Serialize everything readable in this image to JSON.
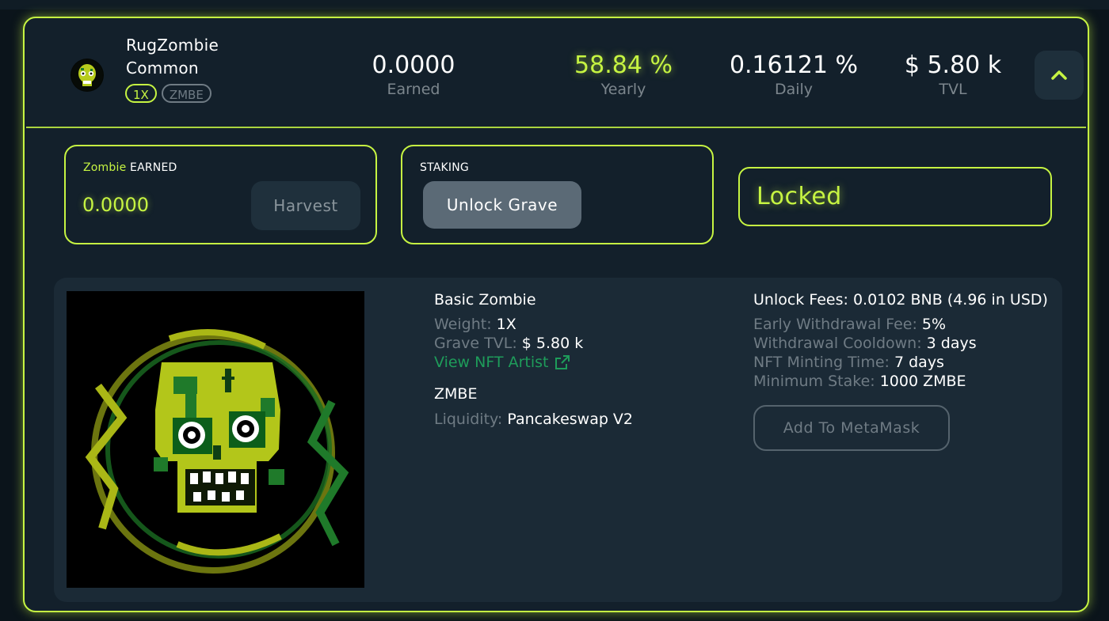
{
  "grave": {
    "name_line1": "RugZombie",
    "name_line2": "Common",
    "multiplier_badge": "1X",
    "token_badge": "ZMBE"
  },
  "stats": {
    "earned_value": "0.0000",
    "earned_label": "Earned",
    "yearly_value": "58.84 %",
    "yearly_label": "Yearly",
    "daily_value": "0.16121 %",
    "daily_label": "Daily",
    "tvl_value": "$ 5.80 k",
    "tvl_label": "TVL"
  },
  "earned_panel": {
    "title_accent": "Zombie",
    "title_rest": "EARNED",
    "value": "0.0000",
    "harvest_label": "Harvest"
  },
  "staking_panel": {
    "title": "STAKING",
    "unlock_label": "Unlock Grave"
  },
  "status": {
    "locked_label": "Locked"
  },
  "details": {
    "nft_name": "Basic Zombie",
    "weight_label": "Weight:",
    "weight_value": "1X",
    "grave_tvl_label": "Grave TVL:",
    "grave_tvl_value": "$ 5.80 k",
    "artist_link": "View NFT Artist",
    "token_name": "ZMBE",
    "liquidity_label": "Liquidity:",
    "liquidity_value": "Pancakeswap V2",
    "unlock_fees": "Unlock Fees: 0.0102 BNB (4.96 in USD)",
    "early_fee_label": "Early Withdrawal Fee:",
    "early_fee_value": "5%",
    "cooldown_label": "Withdrawal Cooldown:",
    "cooldown_value": "3 days",
    "minting_label": "NFT Minting Time:",
    "minting_value": "7 days",
    "min_stake_label": "Minimum Stake:",
    "min_stake_value": "1000 ZMBE",
    "metamask_label": "Add To MetaMask"
  },
  "icons": {
    "expand": "chevron-up-icon",
    "external_link": "external-link-icon",
    "avatar": "zombie-skull-avatar",
    "nft_art": "zombie-skull-art"
  },
  "colors": {
    "accent": "#c6f442",
    "background": "#13202b",
    "details_background": "#1b2a36",
    "muted_text": "#6f7b84",
    "link_green": "#1e9c5a"
  }
}
